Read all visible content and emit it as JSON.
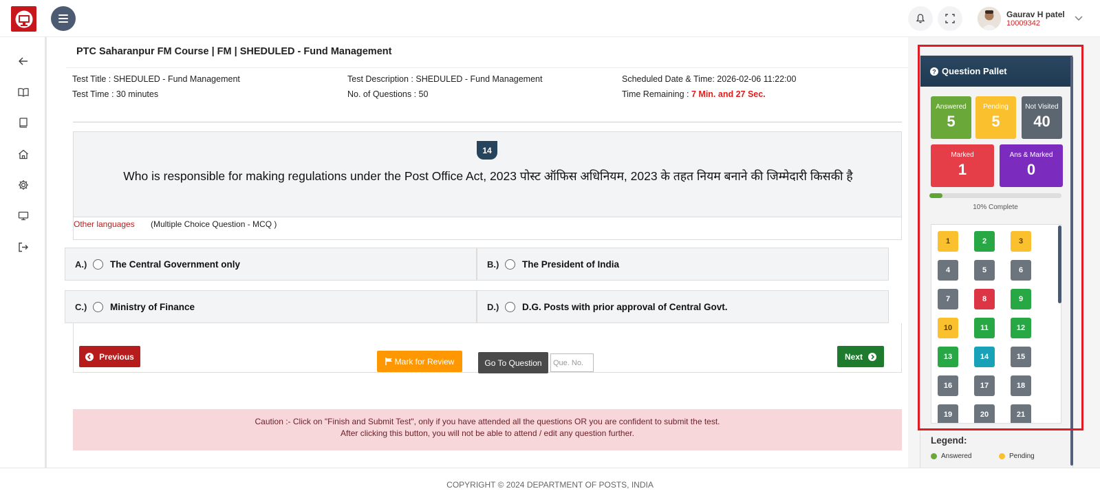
{
  "header": {
    "user_name": "Gaurav H patel",
    "user_id": "10009342"
  },
  "main": {
    "course_title": "PTC Saharanpur FM Course | FM | SHEDULED - Fund Management",
    "test_title_label": "Test Title :",
    "test_title_value": "SHEDULED - Fund Management",
    "test_time_label": "Test Time :",
    "test_time_value": "30 minutes",
    "test_desc_label": "Test Description :",
    "test_desc_value": "SHEDULED - Fund Management",
    "num_questions_label": "No. of Questions :",
    "num_questions_value": "50",
    "scheduled_label": "Scheduled Date & Time:",
    "scheduled_value": "2026-02-06 11:22:00",
    "time_remaining_label": "Time Remaining :",
    "time_remaining_value": "7 Min. and 27 Sec."
  },
  "question": {
    "number": "14",
    "text": "Who is responsible for making regulations under the Post Office Act, 2023 पोस्ट ऑफिस अधिनियम, 2023 के तहत नियम बनाने की जिम्मेदारी किसकी है",
    "other_languages": "Other languages",
    "type": "(Multiple Choice Question - MCQ )",
    "options": [
      {
        "letter": "A.)",
        "text": "The Central Government only"
      },
      {
        "letter": "B.)",
        "text": "The President of India"
      },
      {
        "letter": "C.)",
        "text": "Ministry of Finance"
      },
      {
        "letter": "D.)",
        "text": "D.G. Posts with prior approval of Central Govt."
      }
    ]
  },
  "nav": {
    "previous": "Previous",
    "mark_review": "Mark for Review",
    "go_to": "Go To Question",
    "que_placeholder": "Que. No.",
    "next": "Next"
  },
  "caution": {
    "line1": "Caution :- Click on \"Finish and Submit Test\", only if you have attended all the questions OR you are confident to submit the test.",
    "line2": "After clicking this button, you will not be able to attend / edit any question further."
  },
  "footer": {
    "copyright": "COPYRIGHT © 2024 DEPARTMENT OF POSTS, INDIA"
  },
  "pallet": {
    "title": "Question Pallet",
    "answered_label": "Answered",
    "answered_count": "5",
    "pending_label": "Pending",
    "pending_count": "5",
    "not_visited_label": "Not Visited",
    "not_visited_count": "40",
    "marked_label": "Marked",
    "marked_count": "1",
    "ans_marked_label": "Ans & Marked",
    "ans_marked_count": "0",
    "progress_percent": 10,
    "complete_text": "10% Complete",
    "questions": [
      {
        "n": "1",
        "status": "pending"
      },
      {
        "n": "2",
        "status": "answered"
      },
      {
        "n": "3",
        "status": "pending"
      },
      {
        "n": "4",
        "status": "not-visited"
      },
      {
        "n": "5",
        "status": "not-visited"
      },
      {
        "n": "6",
        "status": "not-visited"
      },
      {
        "n": "7",
        "status": "not-visited"
      },
      {
        "n": "8",
        "status": "marked"
      },
      {
        "n": "9",
        "status": "answered"
      },
      {
        "n": "10",
        "status": "pending"
      },
      {
        "n": "11",
        "status": "answered"
      },
      {
        "n": "12",
        "status": "answered"
      },
      {
        "n": "13",
        "status": "answered"
      },
      {
        "n": "14",
        "status": "current"
      },
      {
        "n": "15",
        "status": "not-visited"
      },
      {
        "n": "16",
        "status": "not-visited"
      },
      {
        "n": "17",
        "status": "not-visited"
      },
      {
        "n": "18",
        "status": "not-visited"
      },
      {
        "n": "19",
        "status": "not-visited"
      },
      {
        "n": "20",
        "status": "not-visited"
      },
      {
        "n": "21",
        "status": "not-visited"
      }
    ],
    "legend_title": "Legend:",
    "legend": [
      {
        "label": "Answered",
        "color": "#6aa83a"
      },
      {
        "label": "Pending",
        "color": "#fbc02d"
      }
    ]
  },
  "colors": {
    "answered": "#28a745",
    "pending": "#fbc02d",
    "not_visited": "#6c757d",
    "marked": "#dc3545",
    "current": "#17a2b8",
    "ans_marked": "#7b2cbf"
  }
}
